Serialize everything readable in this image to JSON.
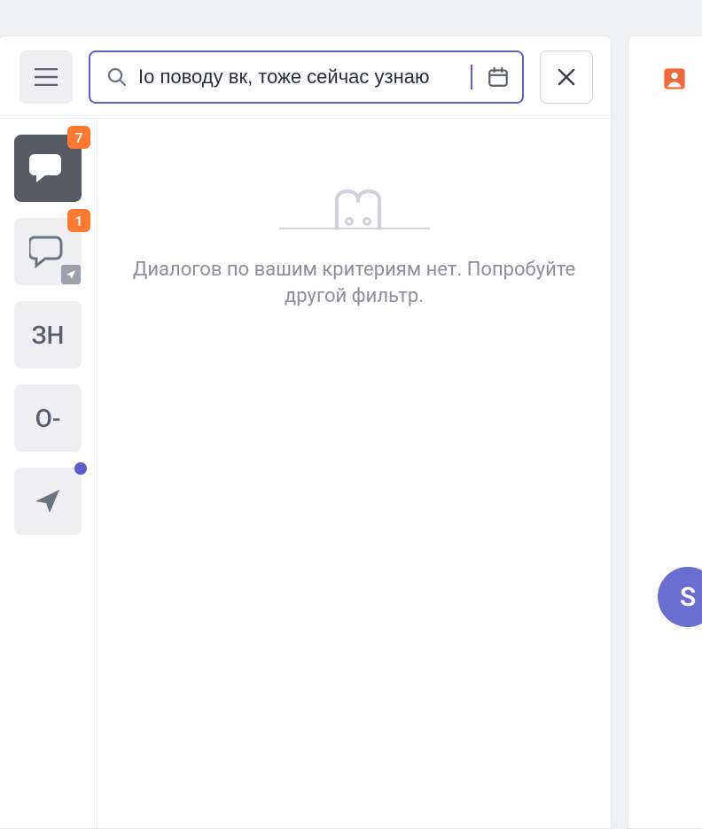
{
  "toolbar": {
    "search_value": "Iо поводу вк, тоже сейчас узнаю"
  },
  "channels": [
    {
      "name": "chat-filled",
      "badge": "7",
      "active": true,
      "text": ""
    },
    {
      "name": "chat-outline",
      "badge": "1",
      "active": false,
      "text": "",
      "corner": true
    },
    {
      "name": "zn",
      "badge": null,
      "active": false,
      "text": "ЗН"
    },
    {
      "name": "o-dash",
      "badge": null,
      "active": false,
      "text": "О-"
    },
    {
      "name": "send",
      "dot": true,
      "active": false,
      "text": ""
    }
  ],
  "empty_state": {
    "message": "Диалогов по вашим критериям нет. Попробуйте другой фильтр."
  },
  "fab": {
    "letter": "S"
  }
}
